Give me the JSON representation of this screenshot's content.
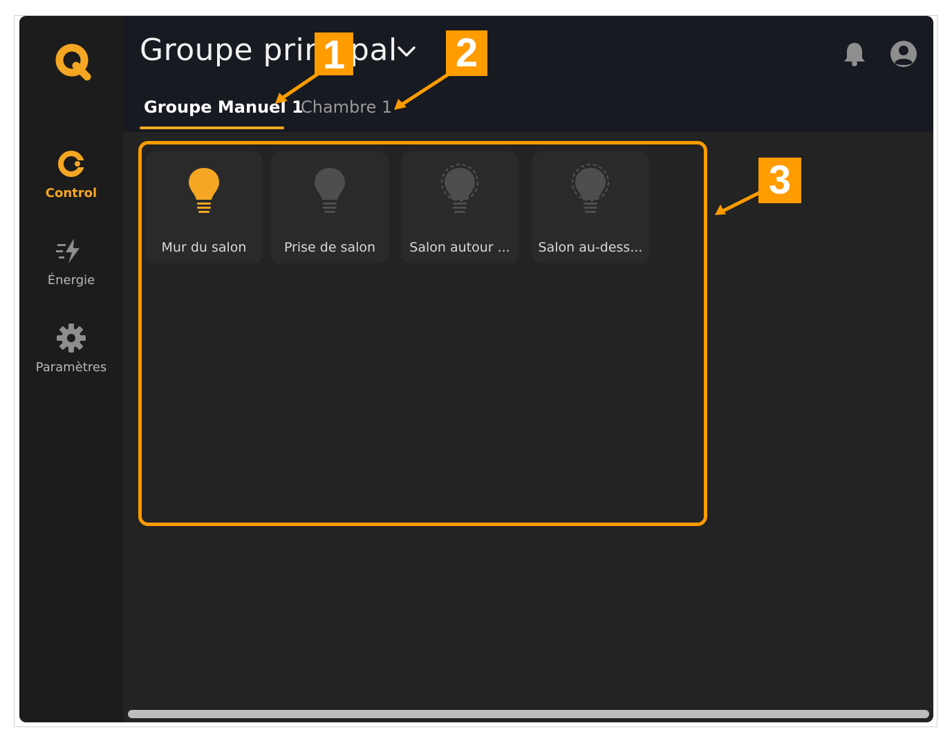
{
  "app": {
    "group_title": "Groupe principal",
    "accent_color": "#f5a623",
    "logo_icon": "q-logo-icon"
  },
  "sidebar": {
    "items": [
      {
        "label": "Control",
        "icon": "control-icon",
        "active": true
      },
      {
        "label": "Énergie",
        "icon": "energy-icon",
        "active": false
      },
      {
        "label": "Paramètres",
        "icon": "gear-icon",
        "active": false
      }
    ]
  },
  "header": {
    "icons": [
      "bell-icon",
      "user-account-icon"
    ]
  },
  "tabs": [
    {
      "label": "Groupe Manuel 1",
      "active": true
    },
    {
      "label": "Chambre 1",
      "active": false
    }
  ],
  "devices": [
    {
      "label": "Mur du salon",
      "icon": "bulb-icon",
      "state": "on"
    },
    {
      "label": "Prise de salon",
      "icon": "bulb-icon",
      "state": "off"
    },
    {
      "label": "Salon autour ...",
      "icon": "bulb-icon",
      "state": "unavailable"
    },
    {
      "label": "Salon au-dess...",
      "icon": "bulb-icon",
      "state": "unavailable"
    }
  ],
  "annotations": {
    "color": "#ff9c00",
    "labels": [
      "1",
      "2",
      "3"
    ]
  }
}
